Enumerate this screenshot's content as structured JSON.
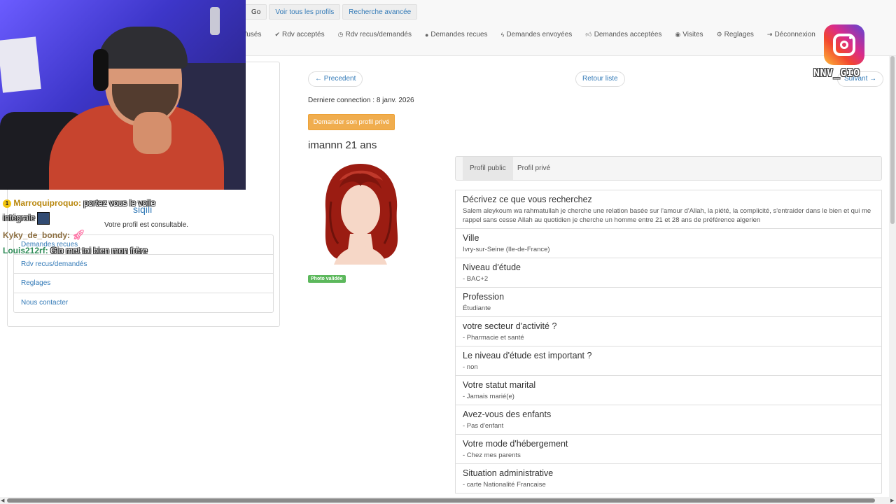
{
  "topbar": {
    "go_label": "Go",
    "all_profiles_label": "Voir tous les profils",
    "advanced_search_label": "Recherche avancée",
    "nav": [
      {
        "icon": "",
        "label": "efusés"
      },
      {
        "icon": "check-circle-icon",
        "label": "Rdv acceptés"
      },
      {
        "icon": "clock-icon",
        "label": "Rdv recus/demandés"
      },
      {
        "icon": "info-circle-icon",
        "label": "Demandes recues"
      },
      {
        "icon": "bolt-icon",
        "label": "Demandes envoyées"
      },
      {
        "icon": "thumbs-up-icon",
        "label": "Demandes acceptées"
      },
      {
        "icon": "eye-icon",
        "label": "Visites"
      },
      {
        "icon": "gear-icon",
        "label": "Reglages"
      },
      {
        "icon": "logout-icon",
        "label": "Déconnexion"
      }
    ]
  },
  "overlay": {
    "instagram_handle": "NNV_GIO"
  },
  "chat": [
    {
      "badge": "1",
      "user": "Marroquiproquo",
      "user_color": "#b8860b",
      "message": "portez vous le voile intégrale"
    },
    {
      "user": "Kyky_de_bondy",
      "user_color": "#8b6d3f",
      "message": ""
    },
    {
      "user": "Louis212rf",
      "user_color": "#2e8b57",
      "message": "Gio met toi bien mon frère"
    }
  ],
  "sidebar": {
    "username": "siqili",
    "status": "Votre profil est consultable.",
    "links": [
      "Demandes recues",
      "Rdv recus/demandés",
      "Reglages",
      "Nous contacter"
    ]
  },
  "profile": {
    "prev_label": "← Precedent",
    "back_label": "Retour liste",
    "next_label": "Suivant →",
    "last_connection": "Derniere connection : 8 janv. 2026",
    "request_private_label": "Demander son profil privé",
    "name_age": "imannn 21 ans",
    "photo_badge": "Photo validée",
    "tabs": [
      "Profil public",
      "Profil privé"
    ],
    "fields": [
      {
        "label": "Décrivez ce que vous recherchez",
        "value": "Salem aleykoum wa rahmatullah je cherche une relation basée sur l'amour d'Allah, la piété, la complicité, s'entraider dans le bien et qui me rappel sans cesse Allah au quotidien je cherche un homme entre 21 et 28 ans de préférence algerien"
      },
      {
        "label": "Ville",
        "value": "Ivry-sur-Seine (Ile-de-France)"
      },
      {
        "label": "Niveau d'étude",
        "value": "- BAC+2"
      },
      {
        "label": "Profession",
        "value": "Étudiante"
      },
      {
        "label": "votre secteur d'activité ?",
        "value": "- Pharmacie et santé"
      },
      {
        "label": "Le niveau d'étude est important ?",
        "value": "- non"
      },
      {
        "label": "Votre statut marital",
        "value": "- Jamais marié(e)"
      },
      {
        "label": "Avez-vous des enfants",
        "value": "- Pas d'enfant"
      },
      {
        "label": "Votre mode d'hébergement",
        "value": "- Chez mes parents"
      },
      {
        "label": "Situation administrative",
        "value": "- carte Nationalité Francaise"
      }
    ]
  }
}
